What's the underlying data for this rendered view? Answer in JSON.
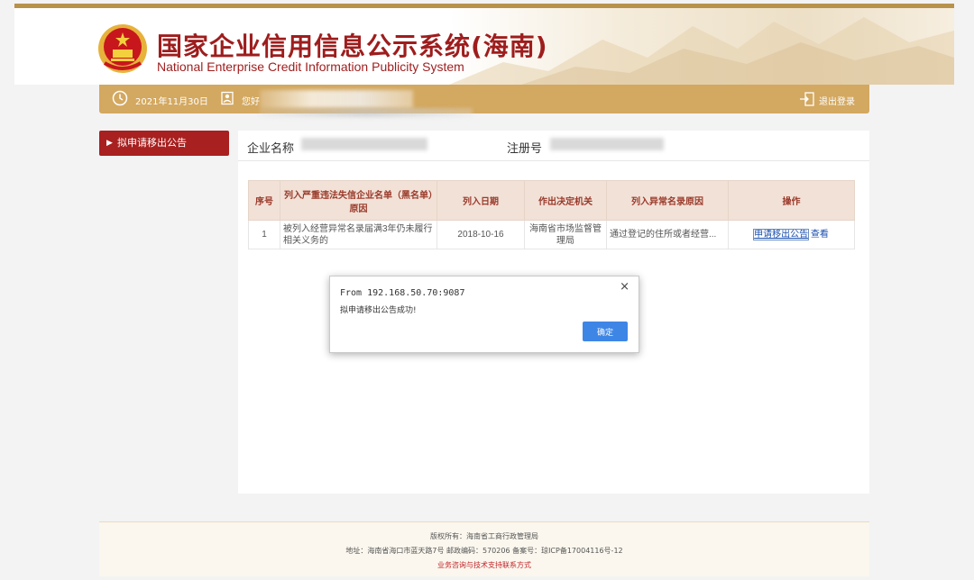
{
  "header": {
    "title_zh": "国家企业信用信息公示系统(海南)",
    "title_en": "National Enterprise Credit Information Publicity System"
  },
  "userbar": {
    "date": "2021年11月30日",
    "greeting": "您好",
    "logout_label": "退出登录"
  },
  "sidebar": {
    "items": [
      {
        "label": "拟申请移出公告"
      }
    ]
  },
  "company_info": {
    "name_label": "企业名称",
    "reg_label": "注册号"
  },
  "table": {
    "headers": [
      "序号",
      "列入严重违法失信企业名单（黑名单）原因",
      "列入日期",
      "作出决定机关",
      "列入异常名录原因",
      "操作"
    ],
    "rows": [
      {
        "index": "1",
        "reason": "被列入经营异常名录届满3年仍未履行相关义务的",
        "date": "2018-10-16",
        "authority": "海南省市场监督管理局",
        "abnormal_reason": "通过登记的住所或者经营...",
        "action_apply": "申请移出公告",
        "action_view": "查看"
      }
    ]
  },
  "dialog": {
    "from": "From 192.168.50.70:9087",
    "message": "拟申请移出公告成功!",
    "ok_label": "确定",
    "close_glyph": "×"
  },
  "footer": {
    "line1": "版权所有：海南省工商行政管理局",
    "line2": "地址：海南省海口市蓝天路7号 邮政编码：570206 备案号：琼ICP备17004116号-12",
    "line3": "业务咨询与技术支持联系方式"
  },
  "colors": {
    "brand_red": "#9e1d1d",
    "gold_bar": "#d3a860",
    "sidebar_active": "#a8201f",
    "table_header": "#f1e1d7",
    "ok_button": "#3e86e6"
  }
}
